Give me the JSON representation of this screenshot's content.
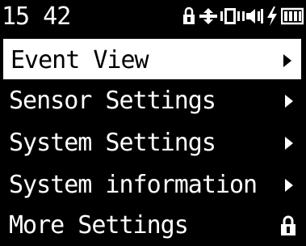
{
  "status_bar": {
    "time": "15 42",
    "icons": [
      "lock-icon",
      "sync-arrows-icon",
      "vibrate-icon",
      "speaker-icon",
      "lightning-icon",
      "battery-icon"
    ]
  },
  "menu": {
    "items": [
      {
        "label": "Event View",
        "selected": true,
        "trailing": "arrow-right-icon"
      },
      {
        "label": "Sensor Settings",
        "selected": false,
        "trailing": "arrow-right-icon"
      },
      {
        "label": "System Settings",
        "selected": false,
        "trailing": "arrow-right-icon"
      },
      {
        "label": "System information",
        "selected": false,
        "trailing": "arrow-right-icon"
      },
      {
        "label": "More Settings",
        "selected": false,
        "trailing": "lock-icon"
      }
    ]
  }
}
